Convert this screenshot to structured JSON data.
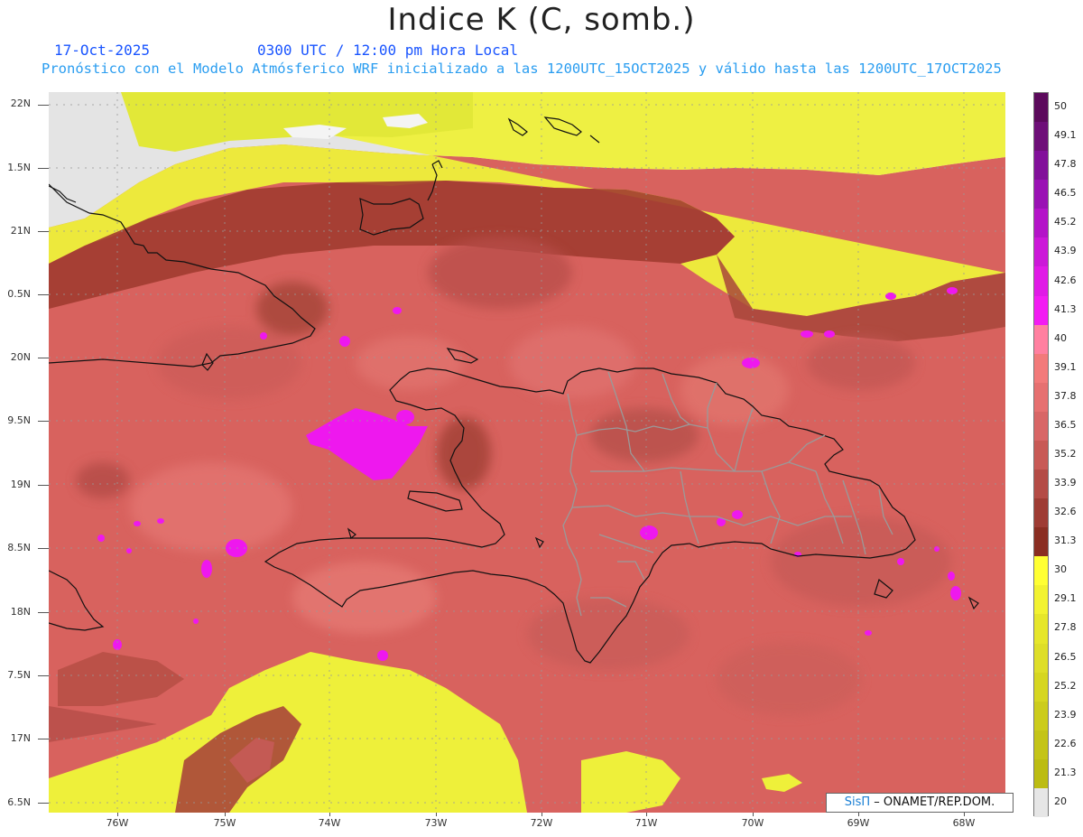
{
  "header": {
    "title": "Indice K (C, somb.)",
    "date": "17-Oct-2025",
    "time": "0300 UTC / 12:00 pm Hora Local",
    "forecast": "Pronóstico con el Modelo Atmósferico WRF inicializado a las 1200UTC_15OCT2025 y válido hasta las  1200UTC_17OCT2025"
  },
  "axes": {
    "lat_labels": [
      "22N",
      "1.5N",
      "21N",
      "0.5N",
      "20N",
      "9.5N",
      "19N",
      "8.5N",
      "18N",
      "7.5N",
      "17N",
      "6.5N"
    ],
    "lon_labels": [
      "76W",
      "75W",
      "74W",
      "73W",
      "72W",
      "71W",
      "70W",
      "69W",
      "68W"
    ]
  },
  "colorbar": {
    "labels": [
      "50",
      "49.1",
      "47.8",
      "46.5",
      "45.2",
      "43.9",
      "42.6",
      "41.3",
      "40",
      "39.1",
      "37.8",
      "36.5",
      "35.2",
      "33.9",
      "32.6",
      "31.3",
      "30",
      "29.1",
      "27.8",
      "26.5",
      "25.2",
      "23.9",
      "22.6",
      "21.3",
      "20"
    ],
    "colors": [
      "#5c0a5c",
      "#6e0f78",
      "#82109a",
      "#9a12b4",
      "#b414c8",
      "#cc18d8",
      "#e01ae6",
      "#f21cf2",
      "#ff80a0",
      "#f27a7a",
      "#e67070",
      "#d86666",
      "#c85a56",
      "#b44c46",
      "#9e3c34",
      "#8a2e22",
      "#ffff33",
      "#f2f230",
      "#e6e62a",
      "#dede28",
      "#d6d620",
      "#cccc1c",
      "#c4c418",
      "#bcbc12",
      "#e6e6e6"
    ]
  },
  "credit": {
    "brand": "SisΠ",
    "text": " – ONAMET/REP.DOM."
  }
}
